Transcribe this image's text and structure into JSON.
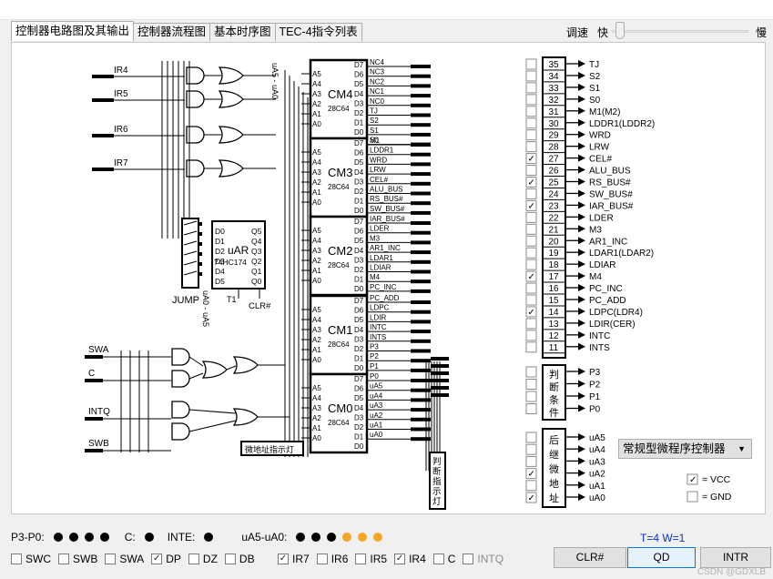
{
  "window": {
    "title": "微程序控制器与处理器实验"
  },
  "tabs": [
    "控制器电路图及其输出",
    "控制器流程图",
    "基本时序图",
    "TEC-4指令列表"
  ],
  "speed": {
    "label": "调速",
    "fast": "快",
    "slow": "慢"
  },
  "diagram": {
    "ir_inputs": [
      "IR4",
      "IR5",
      "IR6",
      "IR7"
    ],
    "other_inputs": [
      "SWA",
      "C",
      "INTQ",
      "SWB"
    ],
    "ua_top_label": "uA5 - uA0",
    "ua_bottom_label": "uA0 - uA5",
    "uar": {
      "name": "uAR",
      "chip": "74HC174",
      "d": [
        "D0",
        "D1",
        "D2",
        "D3",
        "D4",
        "D5"
      ],
      "q": [
        "Q5",
        "Q4",
        "Q3",
        "Q2",
        "Q1",
        "Q0"
      ],
      "t1": "T1",
      "clr": "CLR#"
    },
    "jump_label": "JUMP",
    "micro_addr_light": "微地址指示灯",
    "judge_light": [
      "判",
      "断",
      "指",
      "示",
      "灯"
    ],
    "rom_addr_pins": [
      "A5",
      "A4",
      "A3",
      "A2",
      "A1",
      "A0"
    ],
    "rom_data_pins": [
      "D7",
      "D6",
      "D5",
      "D4",
      "D3",
      "D2",
      "D1",
      "D0"
    ],
    "chips": [
      {
        "name": "CM4",
        "part": "28C64",
        "outputs": [
          "NC4",
          "NC3",
          "NC2",
          "NC1",
          "NC0",
          "TJ",
          "S2",
          "S1",
          "S0"
        ]
      },
      {
        "name": "CM3",
        "part": "28C64",
        "outputs": [
          "M1",
          "LDDR1",
          "WRD",
          "LRW",
          "CEL#",
          "ALU_BUS",
          "RS_BUS#",
          "SW_BUS#"
        ]
      },
      {
        "name": "CM2",
        "part": "28C64",
        "outputs": [
          "IAR_BUS#",
          "LDER",
          "M3",
          "AR1_INC",
          "LDAR1",
          "LDIAR",
          "M4",
          "PC_INC"
        ]
      },
      {
        "name": "CM1",
        "part": "28C64",
        "outputs": [
          "PC_ADD",
          "LDPC",
          "LDIR",
          "INTC",
          "INTS",
          "P3",
          "P2",
          "P1"
        ]
      },
      {
        "name": "CM0",
        "part": "28C64",
        "outputs": [
          "P0",
          "uA5",
          "uA4",
          "uA3",
          "uA2",
          "uA1",
          "uA0"
        ]
      }
    ]
  },
  "signals": [
    {
      "num": "35",
      "name": "TJ",
      "checked": false
    },
    {
      "num": "34",
      "name": "S2",
      "checked": false
    },
    {
      "num": "33",
      "name": "S1",
      "checked": false
    },
    {
      "num": "32",
      "name": "S0",
      "checked": false
    },
    {
      "num": "31",
      "name": "M1(M2)",
      "checked": false
    },
    {
      "num": "30",
      "name": "LDDR1(LDDR2)",
      "checked": false
    },
    {
      "num": "29",
      "name": "WRD",
      "checked": false
    },
    {
      "num": "28",
      "name": "LRW",
      "checked": false
    },
    {
      "num": "27",
      "name": "CEL#",
      "checked": true
    },
    {
      "num": "26",
      "name": "ALU_BUS",
      "checked": false
    },
    {
      "num": "25",
      "name": "RS_BUS#",
      "checked": true
    },
    {
      "num": "24",
      "name": "SW_BUS#",
      "checked": false
    },
    {
      "num": "23",
      "name": "IAR_BUS#",
      "checked": true
    },
    {
      "num": "22",
      "name": "LDER",
      "checked": false
    },
    {
      "num": "21",
      "name": "M3",
      "checked": false
    },
    {
      "num": "20",
      "name": "AR1_INC",
      "checked": false
    },
    {
      "num": "19",
      "name": "LDAR1(LDAR2)",
      "checked": false
    },
    {
      "num": "18",
      "name": "LDIAR",
      "checked": false
    },
    {
      "num": "17",
      "name": "M4",
      "checked": true
    },
    {
      "num": "16",
      "name": "PC_INC",
      "checked": false
    },
    {
      "num": "15",
      "name": "PC_ADD",
      "checked": false
    },
    {
      "num": "14",
      "name": "LDPC(LDR4)",
      "checked": true
    },
    {
      "num": "13",
      "name": "LDIR(CER)",
      "checked": false
    },
    {
      "num": "12",
      "name": "INTC",
      "checked": false
    },
    {
      "num": "11",
      "name": "INTS",
      "checked": false
    }
  ],
  "judge_group": {
    "label": [
      "判",
      "断",
      "条",
      "件"
    ],
    "items": [
      {
        "name": "P3",
        "checked": false
      },
      {
        "name": "P2",
        "checked": false
      },
      {
        "name": "P1",
        "checked": false
      },
      {
        "name": "P0",
        "checked": false
      }
    ]
  },
  "next_group": {
    "label": [
      "后",
      "继",
      "微",
      "地",
      "址"
    ],
    "items": [
      {
        "name": "uA5",
        "checked": false
      },
      {
        "name": "uA4",
        "checked": false
      },
      {
        "name": "uA3",
        "checked": false
      },
      {
        "name": "uA2",
        "checked": true
      },
      {
        "name": "uA1",
        "checked": false
      },
      {
        "name": "uA0",
        "checked": true
      }
    ]
  },
  "controller_select": "常规型微程序控制器",
  "power": [
    {
      "name": "VCC",
      "checked": true
    },
    {
      "name": "GND",
      "checked": false
    }
  ],
  "status_row": {
    "p_label": "P3-P0:",
    "c_label": "C:",
    "inte_label": "INTE:",
    "ua_label": "uA5-uA0:",
    "tw": "T=4 W=1",
    "tw_color": "#0033cc"
  },
  "switches_left": [
    {
      "name": "SWC",
      "checked": false
    },
    {
      "name": "SWB",
      "checked": false
    },
    {
      "name": "SWA",
      "checked": false
    },
    {
      "name": "DP",
      "checked": true
    },
    {
      "name": "DZ",
      "checked": false
    },
    {
      "name": "DB",
      "checked": false
    }
  ],
  "switches_right": [
    {
      "name": "IR7",
      "checked": true
    },
    {
      "name": "IR6",
      "checked": false
    },
    {
      "name": "IR5",
      "checked": false
    },
    {
      "name": "IR4",
      "checked": true
    },
    {
      "name": "C",
      "checked": false
    },
    {
      "name": "INTQ",
      "checked": false
    }
  ],
  "buttons": {
    "clr": "CLR#",
    "qd": "QD",
    "intr": "INTR"
  },
  "watermark": "CSDN @GDXLB"
}
